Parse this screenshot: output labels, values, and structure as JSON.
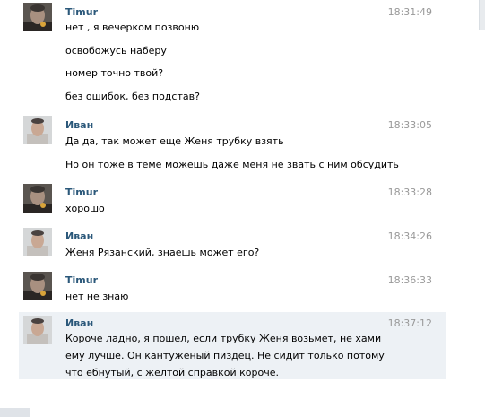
{
  "messages": [
    {
      "author": "Timur",
      "time": "18:31:49",
      "avatar": "dark-face-avatar",
      "lines": [
        "нет , я вечерком позвоню",
        "освобожусь наберу",
        "номер точно твой?",
        "без ошибок, без подстав?"
      ]
    },
    {
      "author": "Иван",
      "time": "18:33:05",
      "avatar": "light-face-avatar",
      "lines": [
        "Да да, так может еще Женя трубку взять",
        "Но он тоже в теме можешь даже меня не звать с ним обсудить"
      ]
    },
    {
      "author": "Timur",
      "time": "18:33:28",
      "avatar": "dark-face-avatar",
      "lines": [
        "хорошо"
      ]
    },
    {
      "author": "Иван",
      "time": "18:34:26",
      "avatar": "light-face-avatar",
      "lines": [
        "Женя Рязанский, знаешь может его?"
      ]
    },
    {
      "author": "Timur",
      "time": "18:36:33",
      "avatar": "dark-face-avatar",
      "lines": [
        "нет не знаю"
      ]
    },
    {
      "author": "Иван",
      "time": "18:37:12",
      "avatar": "light-face-avatar",
      "highlighted": true,
      "paragraph": "Короче ладно, я пошел, если трубку Женя возьмет, не хами ему лучше. Он кантуженый пиздец. Не сидит только потому что ебнутый, с желтой справкой короче."
    }
  ],
  "colors": {
    "author": "#2b587a",
    "time": "#999999",
    "highlight": "#edf1f5"
  }
}
